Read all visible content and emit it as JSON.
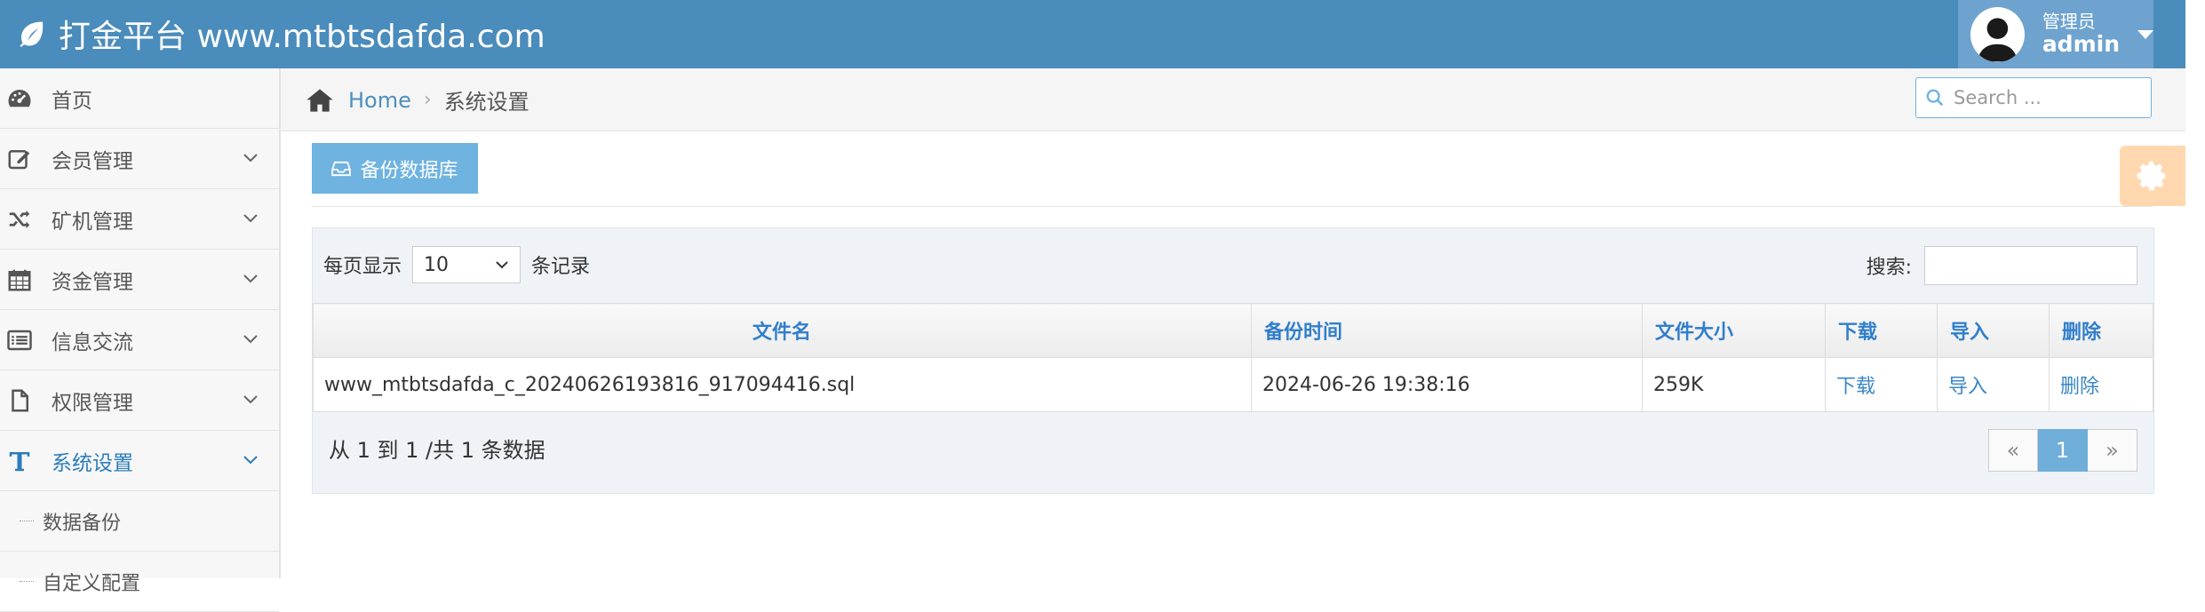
{
  "header": {
    "brand": "打金平台 www.mtbtsdafda.com"
  },
  "user": {
    "role": "管理员",
    "name": "admin"
  },
  "sidebar": {
    "items": [
      {
        "label": "首页",
        "icon": "dashboard-icon"
      },
      {
        "label": "会员管理",
        "icon": "edit-icon"
      },
      {
        "label": "矿机管理",
        "icon": "shuffle-icon"
      },
      {
        "label": "资金管理",
        "icon": "calendar-icon"
      },
      {
        "label": "信息交流",
        "icon": "list-icon"
      },
      {
        "label": "权限管理",
        "icon": "file-icon"
      },
      {
        "label": "系统设置",
        "icon": "text-icon"
      }
    ],
    "subitems": [
      {
        "label": "数据备份"
      },
      {
        "label": "自定义配置"
      }
    ]
  },
  "breadcrumb": {
    "home": "Home",
    "current": "系统设置"
  },
  "search": {
    "placeholder": "Search ..."
  },
  "toolbar": {
    "backup_label": "备份数据库"
  },
  "table_controls": {
    "length_prefix": "每页显示",
    "length_value": "10",
    "length_suffix": "条记录",
    "filter_label": "搜索:"
  },
  "table": {
    "columns": [
      "文件名",
      "备份时间",
      "文件大小",
      "下载",
      "导入",
      "删除"
    ],
    "rows": [
      {
        "filename": "www_mtbtsdafda_c_20240626193816_917094416.sql",
        "time": "2024-06-26 19:38:16",
        "size": "259K",
        "download": "下载",
        "import": "导入",
        "delete": "删除"
      }
    ]
  },
  "footer": {
    "info": "从 1 到 1 /共 1 条数据",
    "prev": "«",
    "page": "1",
    "next": "»"
  },
  "colors": {
    "topbar": "#4a8cbb",
    "accent": "#6fb3e0",
    "link": "#307ecc",
    "settings_tab": "#ffd8b0"
  }
}
